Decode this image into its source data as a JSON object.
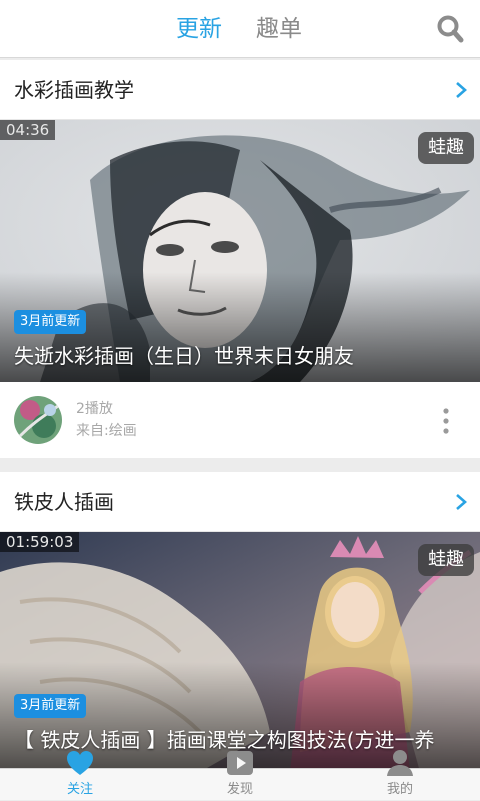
{
  "header": {
    "tabs": [
      {
        "label": "更新",
        "active": true
      },
      {
        "label": "趣单",
        "active": false
      }
    ],
    "search_icon": "search-icon"
  },
  "colors": {
    "accent": "#29a3e3",
    "badge": "#1c8fe0",
    "inactive_text": "#8a8a8a"
  },
  "feed": {
    "cards": [
      {
        "title": "水彩插画教学",
        "video": {
          "duration": "04:36",
          "brand": "蛙趣",
          "updated": "3月前更新",
          "title": "失逝水彩插画（生日）世界末日女朋友"
        },
        "meta": {
          "plays": "2播放",
          "source": "来自:绘画"
        }
      },
      {
        "title": "铁皮人插画",
        "video": {
          "duration": "01:59:03",
          "brand": "蛙趣",
          "updated": "3月前更新",
          "title": "【 铁皮人插画 】插画课堂之构图技法(方进一养"
        }
      }
    ]
  },
  "bottom_nav": {
    "items": [
      {
        "label": "关注",
        "icon": "heart-icon",
        "active": true
      },
      {
        "label": "发现",
        "icon": "play-icon",
        "active": false
      },
      {
        "label": "我的",
        "icon": "user-icon",
        "active": false
      }
    ]
  }
}
